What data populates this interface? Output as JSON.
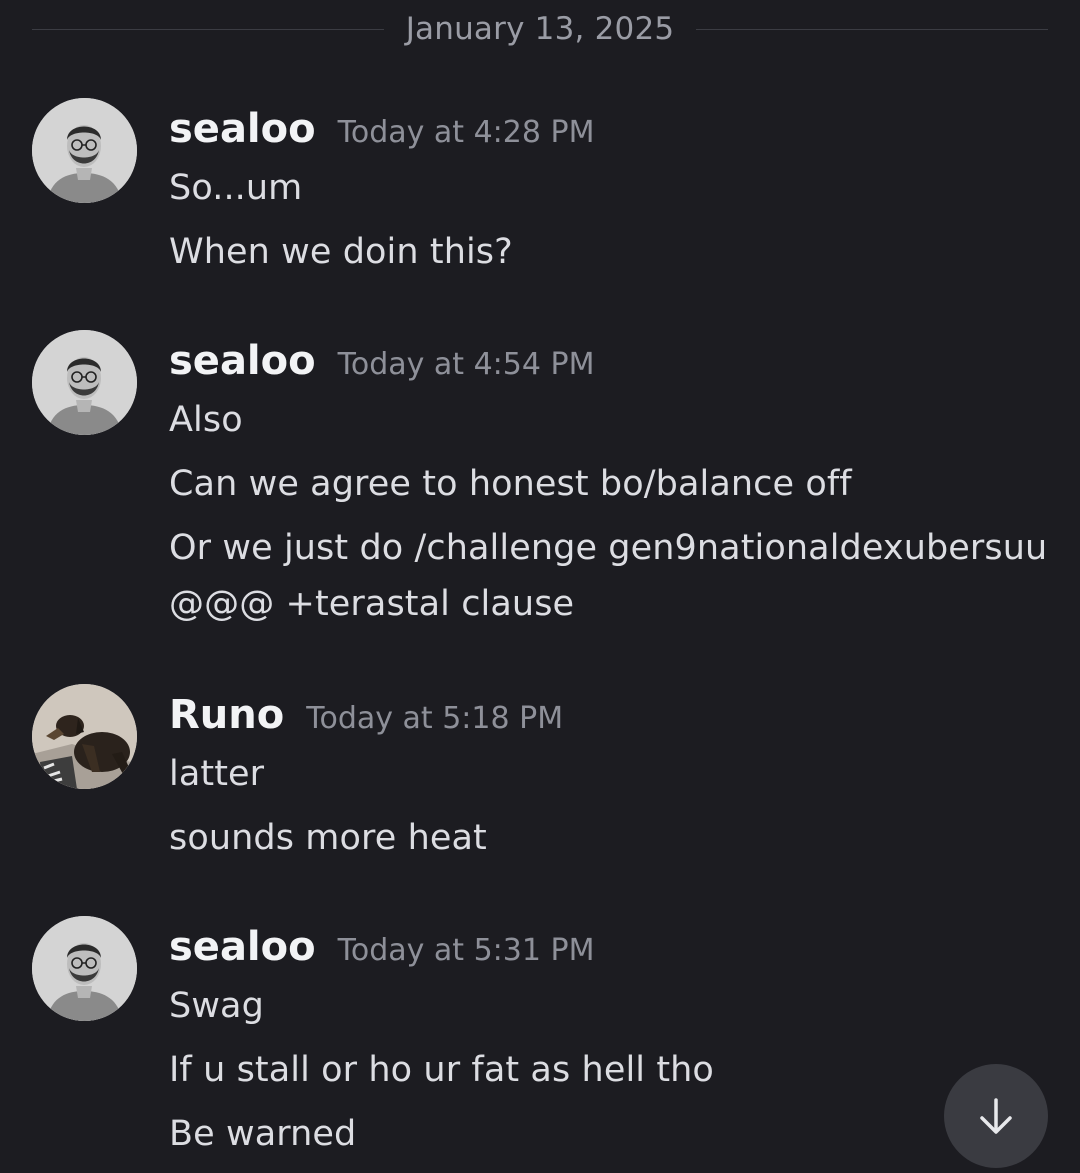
{
  "date_divider": "January 13, 2025",
  "messages": [
    {
      "author": "sealoo",
      "timestamp": "Today at 4:28 PM",
      "avatar": "man-with-glasses-avatar",
      "lines": [
        "So...um",
        "When we doin this?"
      ]
    },
    {
      "author": "sealoo",
      "timestamp": "Today at 4:54 PM",
      "avatar": "man-with-glasses-avatar",
      "lines": [
        "Also",
        "Can we agree to honest bo/balance off",
        "Or we just do /challenge gen9nationaldexubersuu",
        "@@@ +terastal clause"
      ]
    },
    {
      "author": "Runo",
      "timestamp": "Today at 5:18 PM",
      "avatar": "dog-avatar",
      "lines": [
        "latter",
        "sounds more heat"
      ]
    },
    {
      "author": "sealoo",
      "timestamp": "Today at 5:31 PM",
      "avatar": "man-with-glasses-avatar",
      "lines": [
        "Swag",
        "If u stall or ho ur fat as hell tho",
        "Be warned"
      ]
    }
  ],
  "scroll_button_icon": "arrow-down-icon",
  "colors": {
    "background": "#1c1c21",
    "username": "#f2f3f5",
    "timestamp": "#8e9099",
    "message_text": "#dcdde2",
    "scroll_button": "#3a3b41"
  }
}
